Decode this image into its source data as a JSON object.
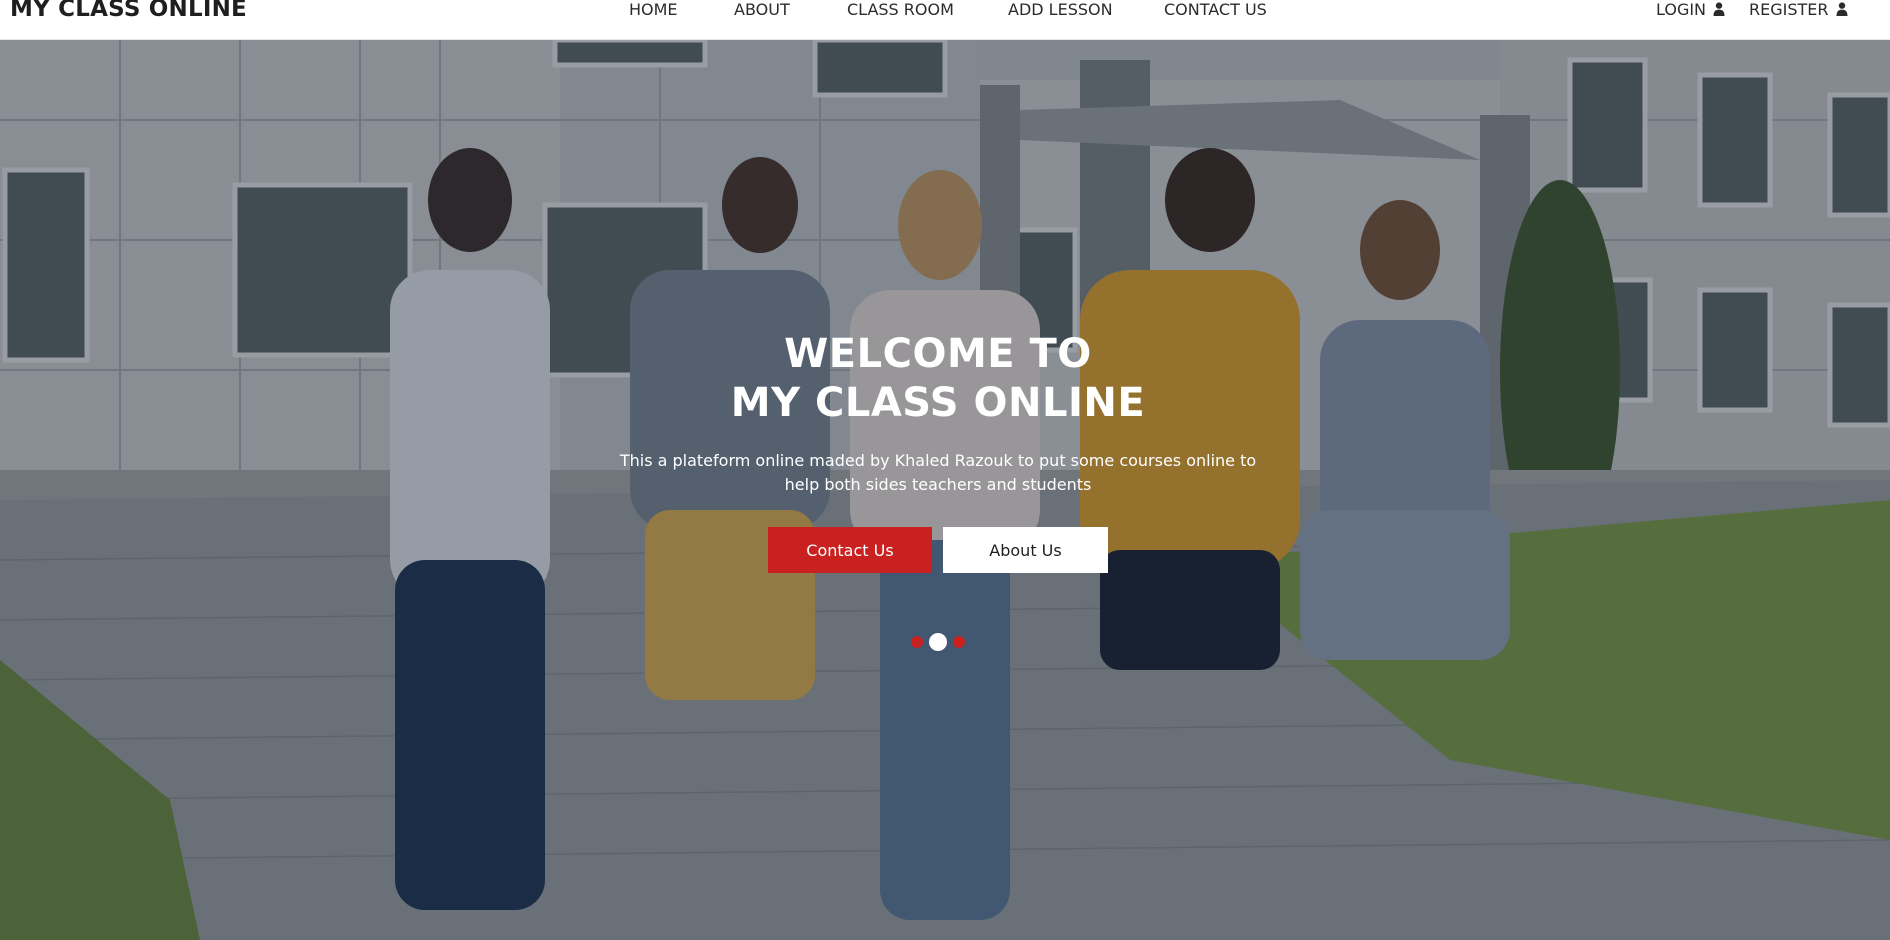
{
  "brand": {
    "name": "MY CLASS ONLINE"
  },
  "nav": {
    "items": [
      {
        "label": "HOME"
      },
      {
        "label": "ABOUT"
      },
      {
        "label": "CLASS ROOM"
      },
      {
        "label": "ADD LESSON"
      },
      {
        "label": "CONTACT US"
      }
    ]
  },
  "auth": {
    "login_label": "LOGIN",
    "register_label": "REGISTER",
    "icon": "user-icon"
  },
  "hero": {
    "title_line1": "WELCOME TO",
    "title_line2": "MY CLASS ONLINE",
    "description": "This a plateform online maded by Khaled Razouk to put some courses online to help both sides teachers and students",
    "primary_button": "Contact Us",
    "secondary_button": "About Us",
    "carousel": {
      "slide_count": 3,
      "active_slide": 2
    }
  },
  "colors": {
    "accent": "#c8211f",
    "nav_text": "#2b2b2b",
    "hero_text": "#ffffff",
    "overlay": "#142034"
  }
}
